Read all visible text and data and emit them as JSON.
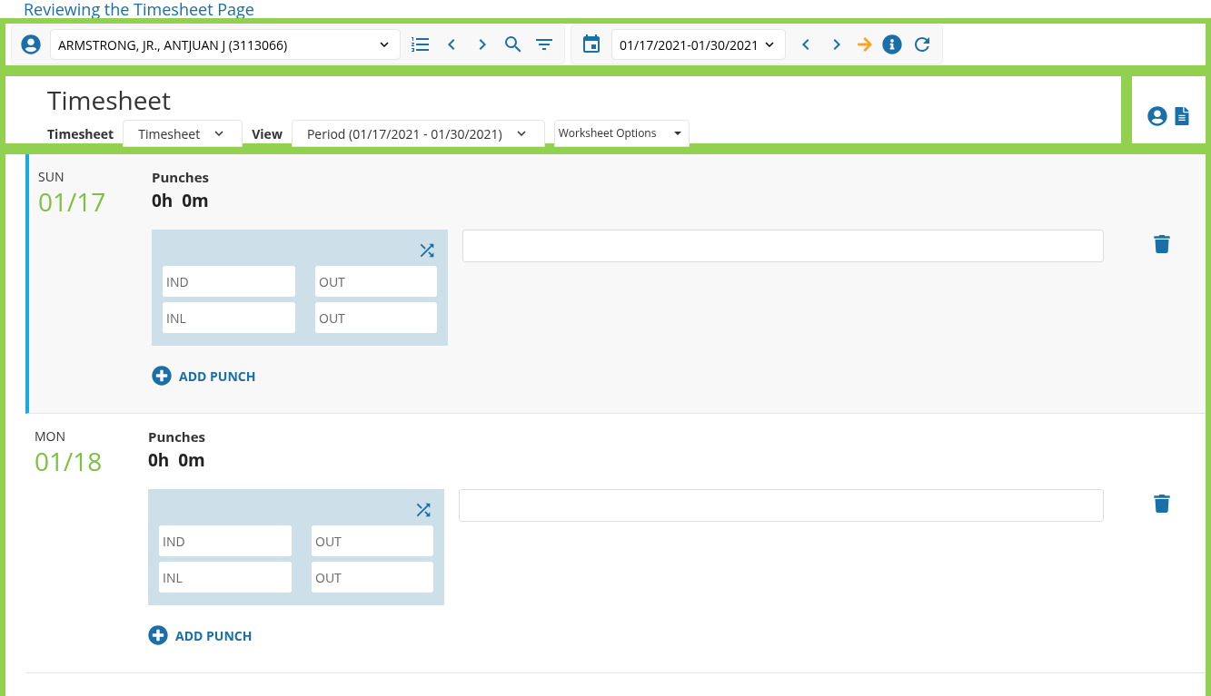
{
  "page_title": "Reviewing the Timesheet Page",
  "toolbar": {
    "employee": {
      "value": "ARMSTRONG, JR., ANTJUAN J (3113066)"
    },
    "period": {
      "value": "01/17/2021-01/30/2021"
    }
  },
  "header": {
    "title": "Timesheet",
    "filters": [
      {
        "kind": "select",
        "label": "Timesheet",
        "value": "Timesheet"
      },
      {
        "kind": "select",
        "label": "View",
        "value": "Period (01/17/2021 - 01/30/2021)"
      },
      {
        "kind": "menu",
        "value": "Worksheet Options"
      }
    ]
  },
  "days": [
    {
      "weekday": "SUN",
      "date": "01/17",
      "selected": true,
      "punches_label": "Punches",
      "total": "0h  0m",
      "punches": [
        {
          "placeholder": "IND"
        },
        {
          "placeholder": "OUT"
        },
        {
          "placeholder": "INL"
        },
        {
          "placeholder": "OUT"
        }
      ],
      "add_label": "ADD PUNCH"
    },
    {
      "weekday": "MON",
      "date": "01/18",
      "selected": false,
      "punches_label": "Punches",
      "total": "0h  0m",
      "punches": [
        {
          "placeholder": "IND"
        },
        {
          "placeholder": "OUT"
        },
        {
          "placeholder": "INL"
        },
        {
          "placeholder": "OUT"
        }
      ],
      "add_label": "ADD PUNCH"
    }
  ]
}
